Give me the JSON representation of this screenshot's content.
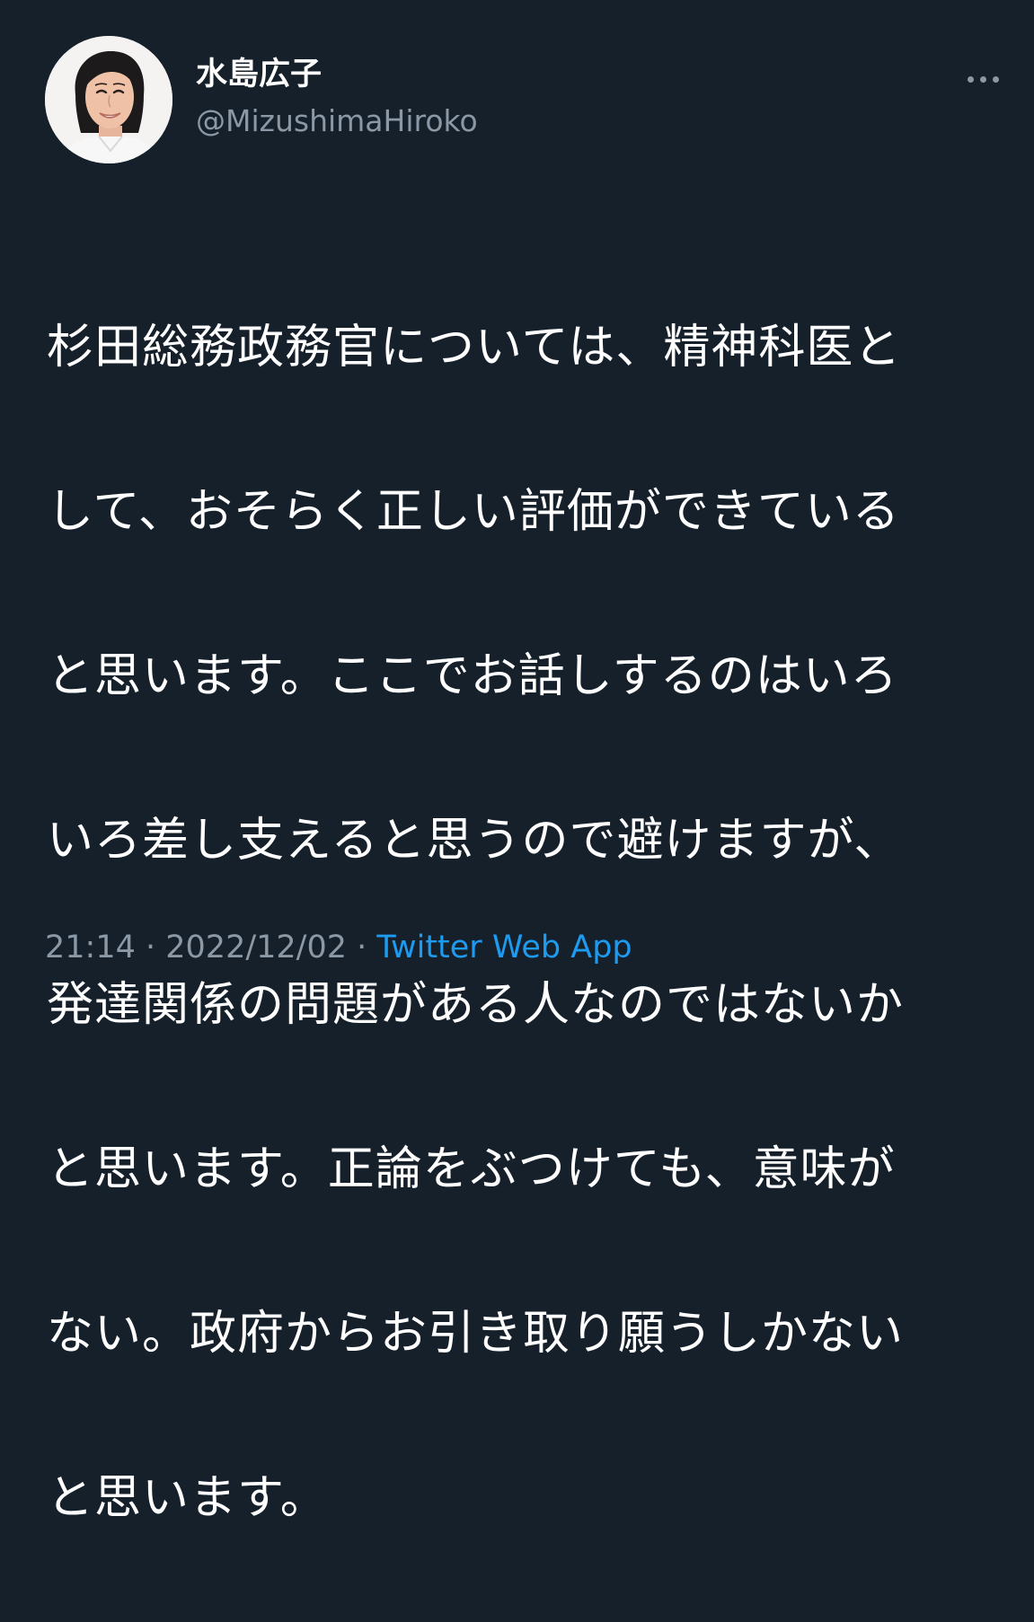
{
  "author": {
    "display_name": "水島広子",
    "handle": "@MizushimaHiroko",
    "avatar_icon": "profile-photo"
  },
  "more_icon": "more-horizontal-icon",
  "tweet": {
    "text": "杉田総務政務官については、精神科医として、おそらく正しい評価ができていると思います。ここでお話しするのはいろいろ差し支えると思うので避けますが、発達関係の問題がある人なのではないかと思います。正論をぶつけても、意味がない。政府からお引き取り願うしかないと思います。",
    "lines": [
      "杉田総務政務官については、精神科医と",
      "して、おそらく正しい評価ができている",
      "と思います。ここでお話しするのはいろ",
      "いろ差し支えると思うので避けますが、",
      "発達関係の問題がある人なのではないか",
      "と思います。正論をぶつけても、意味が",
      "ない。政府からお引き取り願うしかない",
      "と思います。"
    ]
  },
  "meta": {
    "time": "21:14",
    "separator": " · ",
    "date": "2022/12/02",
    "source": "Twitter Web App"
  },
  "colors": {
    "background": "#15202b",
    "text_primary": "#ffffff",
    "text_secondary": "#8b98a5",
    "accent": "#1d9bf0"
  }
}
